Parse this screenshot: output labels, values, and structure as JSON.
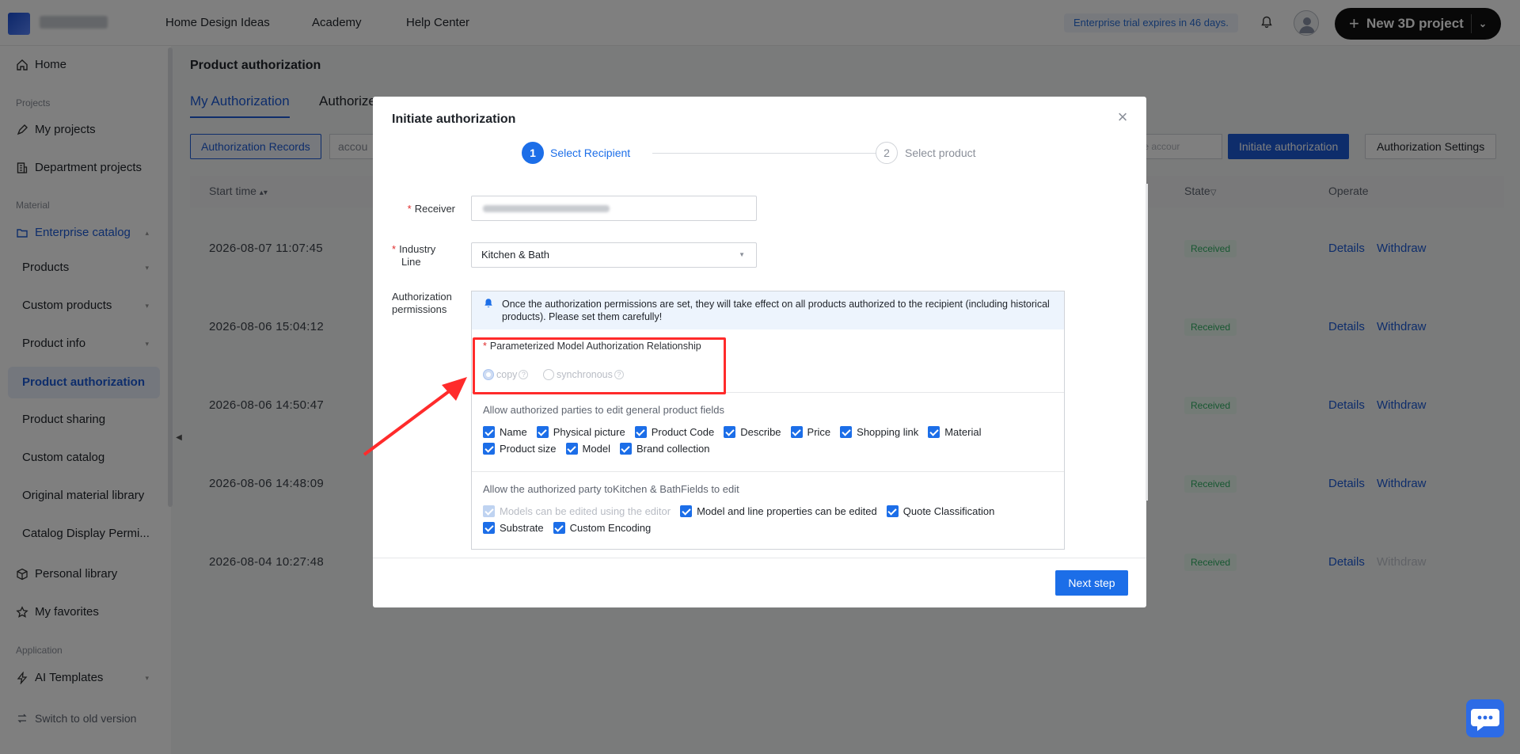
{
  "topbar": {
    "nav": [
      "Home Design Ideas",
      "Academy",
      "Help Center"
    ],
    "trial_text": "Enterprise trial expires in 46 days.",
    "new_project_label": "New 3D project"
  },
  "sidebar": {
    "home": "Home",
    "section_projects": "Projects",
    "my_projects": "My projects",
    "department_projects": "Department projects",
    "section_material": "Material",
    "enterprise_catalog": "Enterprise catalog",
    "items": [
      "Products",
      "Custom products",
      "Product info",
      "Product authorization",
      "Product sharing",
      "Custom catalog",
      "Original material library",
      "Catalog Display Permi..."
    ],
    "personal_library": "Personal library",
    "my_favorites": "My favorites",
    "section_application": "Application",
    "ai_templates": "AI Templates",
    "switch_old": "Switch to old version"
  },
  "main": {
    "title": "Product authorization",
    "tabs": [
      "My Authorization",
      "Authorize"
    ],
    "records_button": "Authorization Records",
    "filter_text": "accou",
    "search_placeholder": "te accour",
    "initiate_button": "Initiate authorization",
    "settings_button": "Authorization Settings",
    "columns": {
      "start_time": "Start time",
      "state": "State",
      "operate": "Operate"
    },
    "rows": [
      {
        "time": "2026-08-07 11:07:45",
        "state": "Received",
        "details": "Details",
        "withdraw": "Withdraw"
      },
      {
        "time": "2026-08-06 15:04:12",
        "state": "Received",
        "details": "Details",
        "withdraw": "Withdraw"
      },
      {
        "time": "2026-08-06 14:50:47",
        "state": "Received",
        "details": "Details",
        "withdraw": "Withdraw"
      },
      {
        "time": "2026-08-06 14:48:09",
        "state": "Received",
        "details": "Details",
        "withdraw": "Withdraw"
      },
      {
        "time": "2026-08-04 10:27:48",
        "state": "Received",
        "details": "Details",
        "withdraw": "Withdraw"
      }
    ]
  },
  "modal": {
    "title": "Initiate authorization",
    "steps": [
      {
        "num": "1",
        "label": "Select Recipient"
      },
      {
        "num": "2",
        "label": "Select product"
      }
    ],
    "receiver_label": "Receiver",
    "industry_label_1": "Industry",
    "industry_label_2": "Line",
    "industry_value": "Kitchen & Bath",
    "permissions_label_1": "Authorization",
    "permissions_label_2": "permissions",
    "notice": "Once the authorization permissions are set, they will take effect on all products authorized to the recipient (including historical products). Please set them carefully!",
    "param_label": "Parameterized Model Authorization Relationship",
    "radio_copy": "copy",
    "radio_sync": "synchronous",
    "general_label": "Allow authorized parties to edit general product fields",
    "general_fields_row1": [
      "Name",
      "Physical picture",
      "Product Code",
      "Describe",
      "Price",
      "Shopping link",
      "Material"
    ],
    "general_fields_row2": [
      "Product size",
      "Model",
      "Brand collection"
    ],
    "industry_fields_label": "Allow the authorized party toKitchen & BathFields to edit",
    "industry_disabled_field": "Models can be edited using the editor",
    "industry_fields_row1": [
      "Model and line properties can be edited",
      "Quote Classification"
    ],
    "industry_fields_row2": [
      "Substrate",
      "Custom Encoding"
    ],
    "next_button": "Next step"
  }
}
